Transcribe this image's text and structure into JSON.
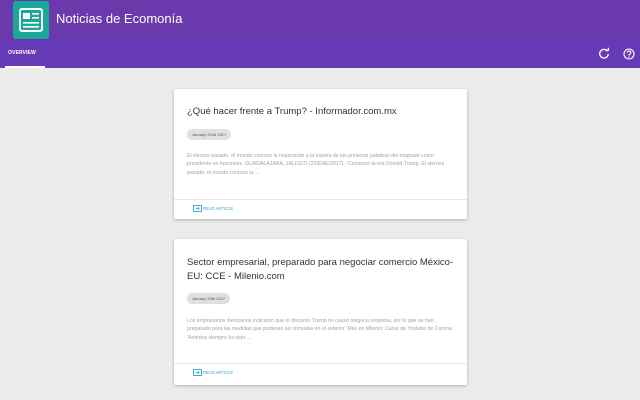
{
  "app": {
    "title": "Noticias de Ecomonía",
    "logo_icon": "newspaper-icon",
    "brand_color": "#6a3aac",
    "logo_color": "#1aa89a"
  },
  "tabs": [
    {
      "label": "OVERVIEW",
      "active": true
    }
  ],
  "toolbar": {
    "refresh_icon": "refresh-icon",
    "help_icon": "help-icon"
  },
  "articles": [
    {
      "title": "¿Qué hacer frente a Trump? - Informador.com.mx",
      "date": "January 22nd 2017",
      "summary": "El viernes pasado, el mundo contuvo la respiración a la espera de las primeras palabras del magnate como presidente en funciones. GUADALAJARA, JALISCO (22/ENE/2017).- Comenzó la era Donald Trump. El viernes pasado, el mundo contuvo la ...",
      "link_label": "READ ARTICLE"
    },
    {
      "title": "Sector empresarial, preparado para negociar comercio México-EU: CCE - Milenio.com",
      "date": "January 20th 2017",
      "summary": "Los empresarios mexicanos indicaron que el discurso Trump no causó ninguna sorpresa, por lo que se han preparado para las medidas que pudieran ser tomadas en el exterior. Más en Milenio: Canal de Youtube de Corona 'América siempre ha sido ...",
      "link_label": "READ ARTICLE"
    }
  ]
}
